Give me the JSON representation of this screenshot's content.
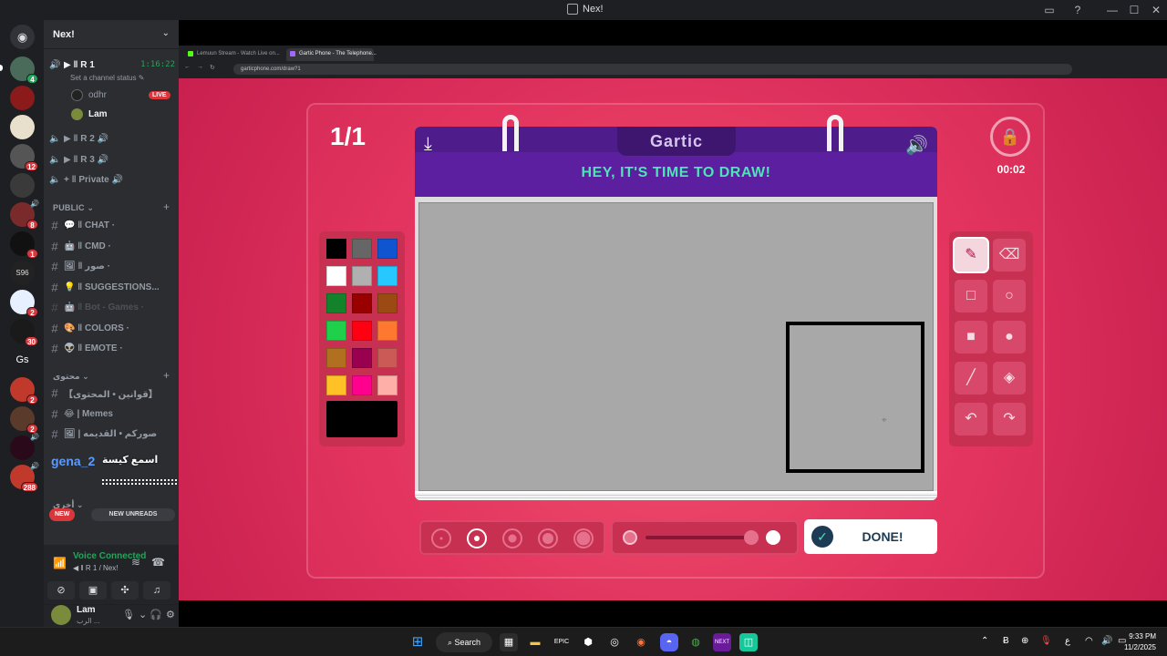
{
  "window": {
    "title": "Nex!"
  },
  "guild": {
    "name": "Nex!"
  },
  "voice_channels": [
    {
      "name": "R 1",
      "timer": "1:16:22",
      "status": "Set a channel status"
    },
    {
      "name": "R 2"
    },
    {
      "name": "R 3"
    },
    {
      "name": "Private"
    }
  ],
  "voice_users": [
    {
      "name": "odhr",
      "badge": "LIVE"
    },
    {
      "name": "Lam"
    }
  ],
  "categories": {
    "public": "PUBLIC",
    "content": "محتوى",
    "extra": "أخرى"
  },
  "text_channels": [
    {
      "name": "CHAT"
    },
    {
      "name": "CMD"
    },
    {
      "name": "صور"
    },
    {
      "name": "SUGGESTIONS..."
    },
    {
      "name": "Bot - Games"
    },
    {
      "name": "COLORS"
    },
    {
      "name": "EMOTE"
    },
    {
      "name": "【قوانين • المحتوى】"
    },
    {
      "name": "Memes"
    },
    {
      "name": "صوركم • القديمه"
    }
  ],
  "servers": [
    {
      "badge": "",
      "vol": ""
    },
    {
      "badge": "",
      "vol": ""
    },
    {
      "badge": "",
      "vol": ""
    },
    {
      "badge": "12",
      "vol": ""
    },
    {
      "badge": "",
      "vol": ""
    },
    {
      "badge": "8",
      "vol": "🔊"
    },
    {
      "badge": "1",
      "vol": ""
    },
    {
      "badge": "",
      "vol": ""
    },
    {
      "badge": "2",
      "vol": ""
    },
    {
      "badge": "30",
      "vol": ""
    },
    {
      "badge": "",
      "vol": ""
    },
    {
      "badge": "2",
      "vol": ""
    },
    {
      "badge": "2",
      "vol": ""
    },
    {
      "badge": "",
      "vol": "🔊"
    },
    {
      "badge": "288",
      "vol": "🔊"
    }
  ],
  "server_text": "Gs",
  "pills": {
    "new": "NEW",
    "unreads": "NEW UNREADS"
  },
  "speaking_overlay": {
    "name": "gena_2",
    "message": "اسمع كيسة"
  },
  "voice_panel": {
    "status": "Voice Connected",
    "channel": "R 1 / Nex!"
  },
  "user_panel": {
    "name": "Lam",
    "status": "الرب ..."
  },
  "browser": {
    "tabs": [
      {
        "label": "Lemuun Stream - Watch Live on..."
      },
      {
        "label": "Gartic Phone - The Telephone..."
      }
    ],
    "url": "garticphone.com/draw?1"
  },
  "game": {
    "round": "1/1",
    "logo": "Gartic",
    "prompt": "HEY, IT'S TIME TO DRAW!",
    "timer": "00:02",
    "done_label": "DONE!",
    "palette": [
      "#000000",
      "#666666",
      "#0f55d0",
      "#ffffff",
      "#b0b0b0",
      "#26c9ff",
      "#14822a",
      "#990000",
      "#9c4a14",
      "#1fd04b",
      "#ff0013",
      "#ff7830",
      "#b07020",
      "#990050",
      "#cb5a57",
      "#ffc125",
      "#ff008f",
      "#feafa8"
    ],
    "selected_color": "#000000",
    "canvas_color": "#a8a8a8",
    "brush_sizes": 5,
    "selected_size_index": 1
  },
  "taskbar": {
    "search": "Search",
    "time": "9:33 PM",
    "date": "11/2/2025"
  }
}
